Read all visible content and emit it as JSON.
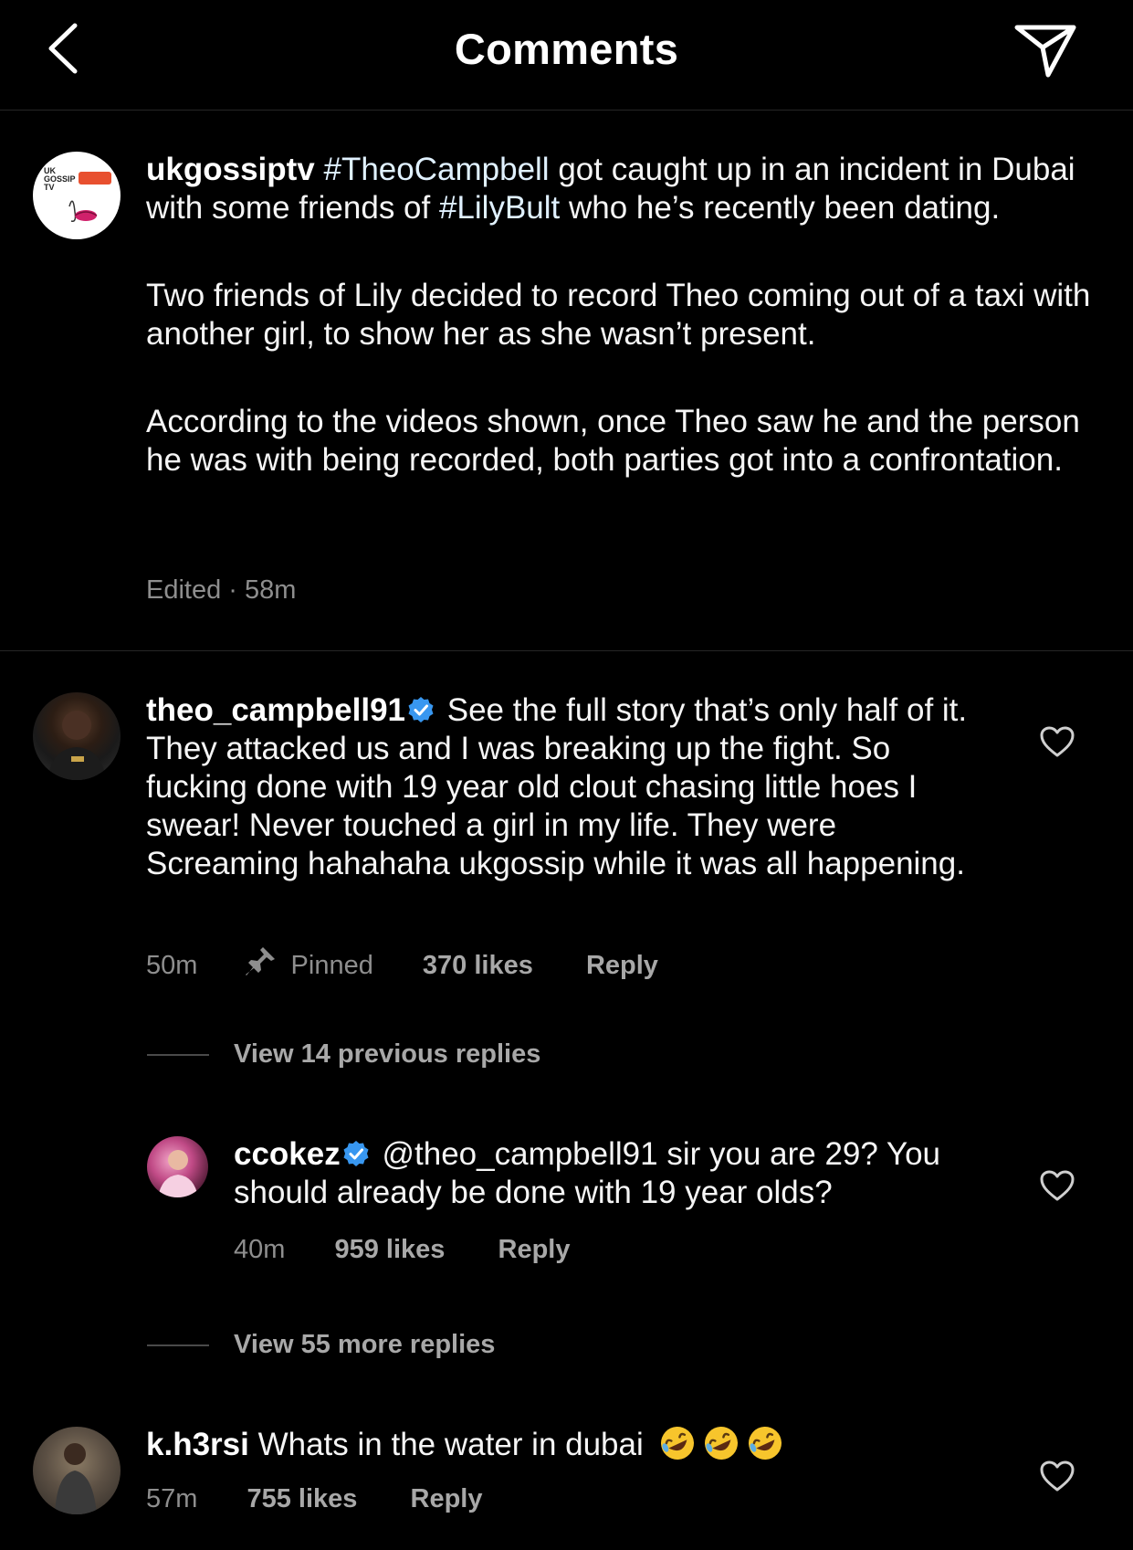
{
  "header": {
    "title": "Comments",
    "back_icon": "chevron-left-icon",
    "send_icon": "paper-plane-icon"
  },
  "caption": {
    "username": "ukgossiptv",
    "avatar_text": "UK GOSSIP TV",
    "p1_tag1": "#TheoCampbell",
    "p1_mid": " got caught up in an incident in Dubai with some friends of ",
    "p1_tag2": "#LilyBult",
    "p1_end": " who he’s recently been dating.",
    "p2": "Two friends of Lily decided to record Theo coming out of a taxi with another girl, to show her as she wasn’t present.",
    "p3": "According to the videos shown, once Theo saw he and the person he was with being recorded, both parties got into a confrontation.",
    "meta": "Edited · 58m"
  },
  "comments": [
    {
      "username": "theo_campbell91",
      "verified": true,
      "text": "See the full story that’s only half of it. They attacked us and I was breaking up the fight. So fucking done with 19 year old clout chasing little hoes I swear! Never touched a girl in my life. They were Screaming hahahaha ukgossip while it was all happening.",
      "time": "50m",
      "pinned": "Pinned",
      "likes": "370 likes",
      "reply": "Reply",
      "view_replies": "View 14 previous replies"
    },
    {
      "username": "ccokez",
      "verified": true,
      "text": "@theo_campbell91 sir you are 29? You should already be done with 19 year olds?",
      "time": "40m",
      "likes": "959 likes",
      "reply": "Reply",
      "view_replies": "View 55 more replies"
    },
    {
      "username": "k.h3rsi",
      "verified": false,
      "text": "Whats in the water in dubai",
      "emoji": "rolling-on-floor-laughing-emoji",
      "time": "57m",
      "likes": "755 likes",
      "reply": "Reply"
    }
  ],
  "colors": {
    "background": "#000000",
    "verified_blue": "#3897f0",
    "meta_gray": "#8e8e8e"
  }
}
